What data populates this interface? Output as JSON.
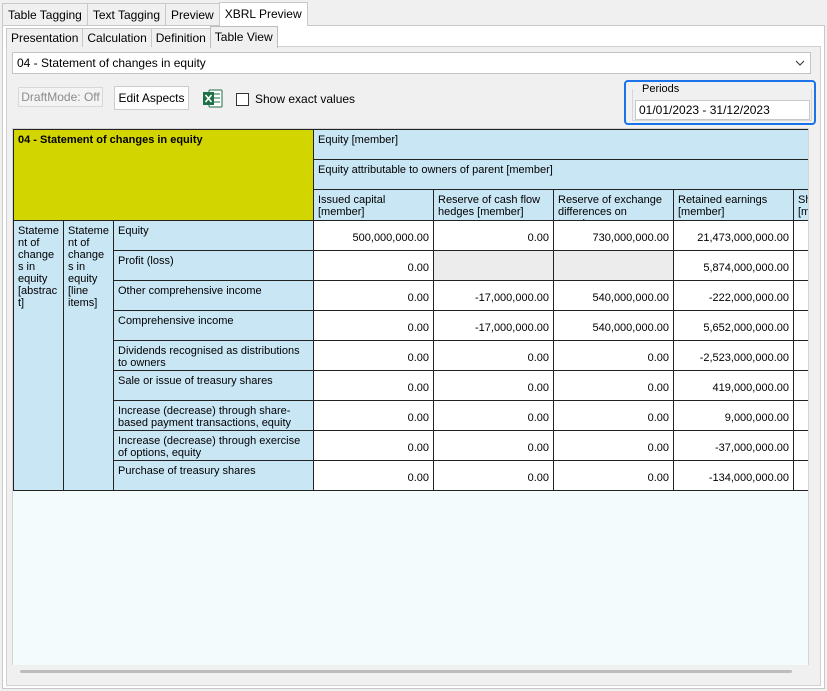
{
  "top_tabs": [
    "Table Tagging",
    "Text Tagging",
    "Preview",
    "XBRL Preview"
  ],
  "sub_tabs": [
    "Presentation",
    "Calculation",
    "Definition",
    "Table View"
  ],
  "table_select": {
    "value": "04 - Statement of changes in equity"
  },
  "toolbar": {
    "draft_mode_label": "DraftMode: Off",
    "edit_aspects_label": "Edit Aspects",
    "show_exact_label": "Show exact values"
  },
  "periods": {
    "legend": "Periods",
    "value": "01/01/2023 - 31/12/2023"
  },
  "grid": {
    "title": "04 - Statement of changes in equity",
    "equity_member": "Equity [member]",
    "parent_member": "Equity attributable to owners of parent [member]",
    "columns": [
      "Issued capital [member]",
      "Reserve of cash flow hedges [member]",
      "Reserve of exchange differences on transla...",
      "Retained earnings [member]",
      "Sh [m"
    ],
    "axis1": "Stateme nt of change s in equity [abstrac t]",
    "axis2": "Stateme nt of change s in equity [line items]",
    "rows": [
      {
        "label": "Equity",
        "values": [
          "500,000,000.00",
          "0.00",
          "730,000,000.00",
          "21,473,000,000.00"
        ]
      },
      {
        "label": "Profit (loss)",
        "values": [
          "0.00",
          "",
          "",
          "5,874,000,000.00"
        ]
      },
      {
        "label": "Other comprehensive income",
        "values": [
          "0.00",
          "-17,000,000.00",
          "540,000,000.00",
          "-222,000,000.00"
        ]
      },
      {
        "label": "Comprehensive income",
        "values": [
          "0.00",
          "-17,000,000.00",
          "540,000,000.00",
          "5,652,000,000.00"
        ]
      },
      {
        "label": "Dividends recognised as distributions to owners",
        "values": [
          "0.00",
          "0.00",
          "0.00",
          "-2,523,000,000.00"
        ]
      },
      {
        "label": "Sale or issue of treasury shares",
        "values": [
          "0.00",
          "0.00",
          "0.00",
          "419,000,000.00"
        ]
      },
      {
        "label": "Increase (decrease) through share-based payment transactions, equity",
        "values": [
          "0.00",
          "0.00",
          "0.00",
          "9,000,000.00"
        ]
      },
      {
        "label": "Increase (decrease) through exercise of options, equity",
        "values": [
          "0.00",
          "0.00",
          "0.00",
          "-37,000,000.00"
        ]
      },
      {
        "label": "Purchase of treasury shares",
        "values": [
          "0.00",
          "0.00",
          "0.00",
          "-134,000,000.00"
        ]
      }
    ]
  },
  "colors": {
    "header_blue": "#c9e6f5",
    "title_yellow": "#d3d500",
    "focus_blue": "#1a73e8"
  }
}
